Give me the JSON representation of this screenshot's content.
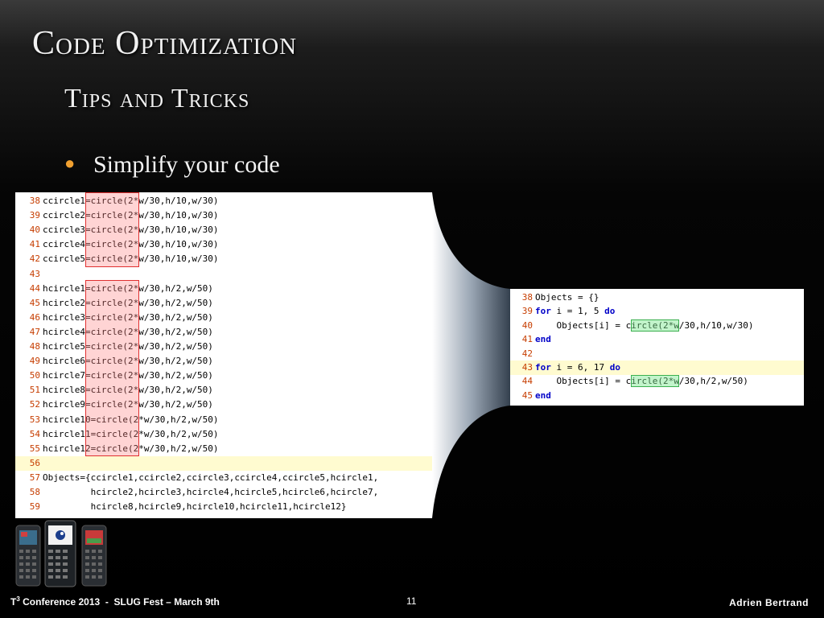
{
  "slide": {
    "title": "Code Optimization",
    "subtitle": "Tips and Tricks",
    "bullet": "Simplify your code"
  },
  "left_code": {
    "lines": [
      {
        "n": "38",
        "pre": "ccircle",
        "mid": "1=circle",
        "post": "(2*w/30,h/10,w/30)"
      },
      {
        "n": "39",
        "pre": "ccircle",
        "mid": "2=circle",
        "post": "(2*w/30,h/10,w/30)"
      },
      {
        "n": "40",
        "pre": "ccircle",
        "mid": "3=circle",
        "post": "(2*w/30,h/10,w/30)"
      },
      {
        "n": "41",
        "pre": "ccircle",
        "mid": "4=circle",
        "post": "(2*w/30,h/10,w/30)"
      },
      {
        "n": "42",
        "pre": "ccircle",
        "mid": "5=circle",
        "post": "(2*w/30,h/10,w/30)"
      },
      {
        "n": "43",
        "pre": "",
        "mid": "",
        "post": ""
      },
      {
        "n": "44",
        "pre": "hcircle",
        "mid": "1=circle",
        "post": "(2*w/30,h/2,w/50)"
      },
      {
        "n": "45",
        "pre": "hcircle",
        "mid": "2=circle",
        "post": "(2*w/30,h/2,w/50)"
      },
      {
        "n": "46",
        "pre": "hcircle",
        "mid": "3=circle",
        "post": "(2*w/30,h/2,w/50)"
      },
      {
        "n": "47",
        "pre": "hcircle",
        "mid": "4=circle",
        "post": "(2*w/30,h/2,w/50)"
      },
      {
        "n": "48",
        "pre": "hcircle",
        "mid": "5=circle",
        "post": "(2*w/30,h/2,w/50)"
      },
      {
        "n": "49",
        "pre": "hcircle",
        "mid": "6=circle",
        "post": "(2*w/30,h/2,w/50)"
      },
      {
        "n": "50",
        "pre": "hcircle",
        "mid": "7=circle",
        "post": "(2*w/30,h/2,w/50)"
      },
      {
        "n": "51",
        "pre": "hcircle",
        "mid": "8=circle",
        "post": "(2*w/30,h/2,w/50)"
      },
      {
        "n": "52",
        "pre": "hcircle",
        "mid": "9=circle",
        "post": "(2*w/30,h/2,w/50)"
      },
      {
        "n": "53",
        "pre": "hcircle",
        "mid": "10=circle",
        "post": "(2*w/30,h/2,w/50)"
      },
      {
        "n": "54",
        "pre": "hcircle",
        "mid": "11=circle",
        "post": "(2*w/30,h/2,w/50)"
      },
      {
        "n": "55",
        "pre": "hcircle",
        "mid": "12=circle",
        "post": "(2*w/30,h/2,w/50)"
      },
      {
        "n": "56",
        "pre": "",
        "mid": "",
        "post": ""
      },
      {
        "n": "57",
        "pre": "Objects={ccircle1,ccircle2,ccircle3,ccircle4,ccircle5,hcircle1,",
        "mid": "",
        "post": ""
      },
      {
        "n": "58",
        "pre": "         hcircle2,hcircle3,hcircle4,hcircle5,hcircle6,hcircle7,",
        "mid": "",
        "post": ""
      },
      {
        "n": "59",
        "pre": "         hcircle8,hcircle9,hcircle10,hcircle11,hcircle12}",
        "mid": "",
        "post": ""
      }
    ]
  },
  "right_code": {
    "lines": [
      {
        "n": "38",
        "t1": "Objects = {}",
        "kw": "",
        "t2": "",
        "call": "",
        "args": ""
      },
      {
        "n": "39",
        "t1": "",
        "kw": "for",
        "t2": " i = 1, 5 ",
        "kw2": "do",
        "call": "",
        "args": ""
      },
      {
        "n": "40",
        "t1": "    Objects[i] = ",
        "kw": "",
        "t2": "",
        "call": "circle",
        "args": "(2*w/30,h/10,w/30)"
      },
      {
        "n": "41",
        "t1": "",
        "kw": "end",
        "t2": "",
        "call": "",
        "args": ""
      },
      {
        "n": "42",
        "t1": "",
        "kw": "",
        "t2": "",
        "call": "",
        "args": ""
      },
      {
        "n": "43",
        "t1": "",
        "kw": "for",
        "t2": " i = 6, 17 ",
        "kw2": "do",
        "call": "",
        "args": ""
      },
      {
        "n": "44",
        "t1": "    Objects[i] = ",
        "kw": "",
        "t2": "",
        "call": "circle",
        "args": "(2*w/30,h/2,w/50)"
      },
      {
        "n": "45",
        "t1": "",
        "kw": "end",
        "t2": "",
        "call": "",
        "args": ""
      }
    ]
  },
  "footer": {
    "conf_t": "T",
    "conf_sup": "3",
    "conf_rest": " Conference 2013  -  SLUG Fest – March 9th",
    "page": "11",
    "author": "Adrien Bertrand"
  },
  "colors": {
    "line_number": "#c63d00",
    "keyword": "#0000c8",
    "highlight_line": "#fffbd0",
    "red_highlight": "#e03030",
    "green_highlight": "#3cb050",
    "bullet": "#f0a030"
  },
  "icons": {
    "calculators": "calculator-images-icon",
    "bullet": "bullet-dot-icon"
  }
}
